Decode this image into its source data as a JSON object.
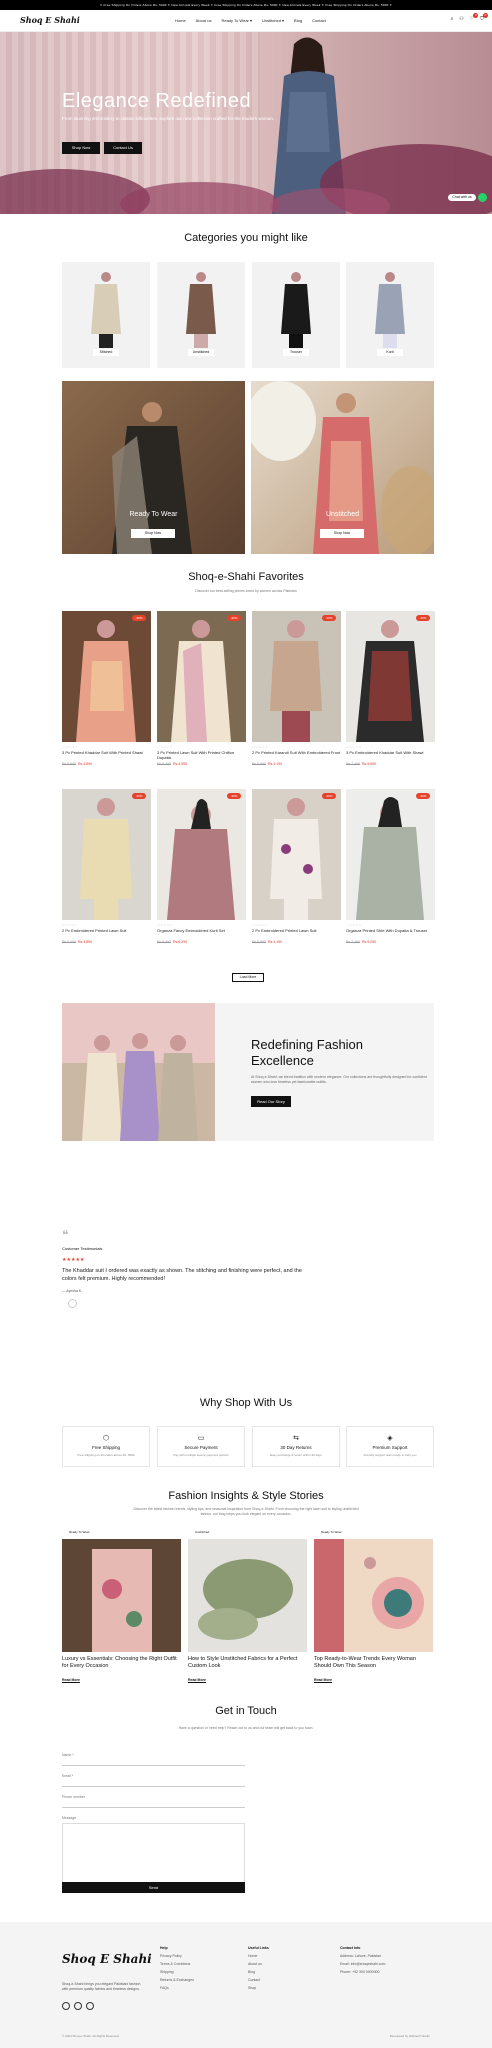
{
  "ticker": "✦ Free Shipping On Orders Above Rs. 5000 ✦ New Arrivals Every Week ✦ Free Shipping On Orders Above Rs. 5000 ✦ New Arrivals Every Week ✦ Free Shipping On Orders Above Rs. 5000 ✦",
  "brand": "Shoq E Shahi",
  "nav": [
    "Home",
    "About us",
    "Ready To Wear ▾",
    "Unstitched ▾",
    "Blog",
    "Contact"
  ],
  "cart_count": "0",
  "hero": {
    "title": "Elegance Redefined",
    "text": "From stunning embroidery to classic silhouettes, explore our new collection crafted for the modern woman.",
    "shop_btn": "Shop Now",
    "contact_btn": "Contact Us"
  },
  "chat": "Chat with us",
  "categories": {
    "title": "Categories you might like",
    "items": [
      "Stitched",
      "Unstitched",
      "Trouser",
      "Kurti"
    ],
    "big": [
      {
        "label": "Ready To Wear",
        "btn": "Shop Now"
      },
      {
        "label": "Unstitched",
        "btn": "Shop Now"
      }
    ]
  },
  "favorites": {
    "title": "Shoq-e-Shahi Favorites",
    "subtitle": "Discover our best-selling pieces loved by women across Pakistan",
    "products": [
      {
        "name": "3 Pc Printed Khaddar Suit With Printed Shawl",
        "old": "Rs.6,990",
        "new": "Rs.4,890",
        "sale": "-30%"
      },
      {
        "name": "3 Pc Printed Lawn Suit With Printed Chiffon Dupatta",
        "old": "Rs.6,490",
        "new": "Rs.4,550",
        "sale": "-30%"
      },
      {
        "name": "2 Pc Printed Karandi Suit With Embroidered Front",
        "old": "Rs.5,990",
        "new": "Rs.4,190",
        "sale": "-30%"
      },
      {
        "name": "3 Pc Embroidered Khaddar Suit With Shawl",
        "old": "Rs.7,990",
        "new": "Rs.5,590",
        "sale": "-30%"
      },
      {
        "name": "2 Pc Embroidered Printed Lawn Suit",
        "old": "Rs.5,490",
        "new": "Rs.3,850",
        "sale": "-30%"
      },
      {
        "name": "Organza Fancy Embroidered Kurti Set",
        "old": "Rs.8,990",
        "new": "Rs.6,290",
        "sale": "-30%"
      },
      {
        "name": "2 Pc Embroidered Printed Lawn Suit",
        "old": "Rs.5,990",
        "new": "Rs.4,190",
        "sale": "-30%"
      },
      {
        "name": "Organza Printed Shirt With Dupatta & Trouser",
        "old": "Rs.7,490",
        "new": "Rs.5,250",
        "sale": "-30%"
      }
    ],
    "load_more": "Load More"
  },
  "promo": {
    "title": "Redefining Fashion Excellence",
    "text": "At Shoq-e-Shahi, we blend tradition with modern elegance. Our collections are thoughtfully designed for confident women who love timeless yet fashionable outfits.",
    "btn": "Read Our Story"
  },
  "testimonial": {
    "heading": "Customer Testimonials",
    "stars": "★★★★★",
    "quote": "The Khaddar suit I ordered was exactly as shown. The stitching and finishing were perfect, and the colors felt premium. Highly recommended!",
    "author": "— Ayesha K."
  },
  "why": {
    "title": "Why Shop With Us",
    "items": [
      {
        "title": "Free Shipping",
        "desc": "Free shipping on all orders above Rs. 5000"
      },
      {
        "title": "Secure Payment",
        "desc": "Pay with multiple secure payment options"
      },
      {
        "title": "30 Day Returns",
        "desc": "Easy exchange & return within 30 days"
      },
      {
        "title": "Premium Support",
        "desc": "Friendly support team ready to help you"
      }
    ]
  },
  "blog": {
    "title": "Fashion Insights & Style Stories",
    "subtitle": "Discover the latest fashion trends, styling tips, and seasonal inspiration from Shoq-e-Shahi. From choosing the right lawn suit to styling unstitched fabrics, our blog helps you look elegant on every occasion.",
    "posts": [
      {
        "tag": "Ready To Wear",
        "title": "Luxury vs Essentials: Choosing the Right Outfit for Every Occasion",
        "link": "Read More"
      },
      {
        "tag": "Unstitched",
        "title": "How to Style Unstitched Fabrics for a Perfect Custom Look",
        "link": "Read More"
      },
      {
        "tag": "Ready To Wear",
        "title": "Top Ready-to-Wear Trends Every Woman Should Own This Season",
        "link": "Read More"
      }
    ]
  },
  "contact": {
    "title": "Get in Touch",
    "subtitle": "Have a question or need help? Reach out to us and our team will get back to you soon.",
    "name": "Name *",
    "email": "Email *",
    "phone": "Phone number",
    "message": "Message",
    "send": "Send"
  },
  "footer": {
    "about": "Shoq-e-Shahi brings you elegant Pakistani fashion with premium quality fabrics and timeless designs.",
    "col1": {
      "h": "Help",
      "items": [
        "Privacy Policy",
        "Terms & Conditions",
        "Shipping",
        "Returns & Exchanges",
        "FAQs"
      ]
    },
    "col2": {
      "h": "Useful Links",
      "items": [
        "Home",
        "About us",
        "Blog",
        "Contact",
        "Shop"
      ]
    },
    "col3": {
      "h": "Contact Info",
      "items": [
        "Address: Lahore, Pakistan",
        "Email: info@shoqeshahi.com",
        "Phone: +92 300 0000000"
      ]
    },
    "copyright": "© 2024 Shoq-e-Shahi. All Rights Reserved.",
    "credit": "Developed by Webtech Studio"
  }
}
